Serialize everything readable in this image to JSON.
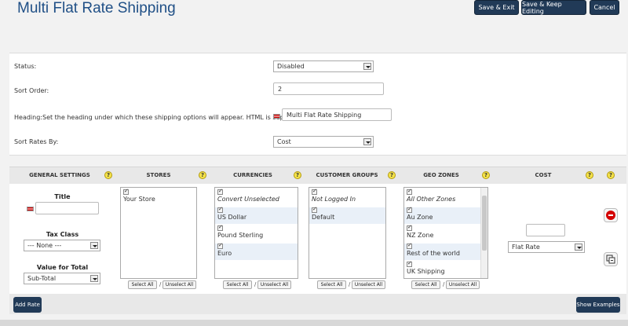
{
  "page": {
    "title": "Multi Flat Rate Shipping"
  },
  "header": {
    "save_exit": "Save & Exit",
    "save_keep": "Save & Keep Editing",
    "cancel": "Cancel"
  },
  "form": {
    "status_label": "Status:",
    "status_value": "Disabled",
    "sort_order_label": "Sort Order:",
    "sort_order_value": "2",
    "heading_label": "Heading:Set the heading under which these shipping options will appear. HTML is supported.",
    "heading_value": "Multi Flat Rate Shipping",
    "sort_rates_label": "Sort Rates By:",
    "sort_rates_value": "Cost"
  },
  "columns": {
    "general": "GENERAL SETTINGS",
    "stores": "STORES",
    "currencies": "CURRENCIES",
    "customer_groups": "CUSTOMER GROUPS",
    "geo_zones": "GEO ZONES",
    "cost": "COST",
    "help": "?"
  },
  "general": {
    "title_label": "Title",
    "title_value": "",
    "tax_class_label": "Tax Class",
    "tax_class_value": "--- None ---",
    "value_total_label": "Value for Total",
    "value_total_value": "Sub-Total"
  },
  "stores": [
    {
      "label": "Your Store",
      "italic": false
    }
  ],
  "currencies": [
    {
      "label": "Convert Unselected",
      "italic": true
    },
    {
      "label": "US Dollar",
      "italic": false
    },
    {
      "label": "Pound Sterling",
      "italic": false
    },
    {
      "label": "Euro",
      "italic": false
    }
  ],
  "customer_groups": [
    {
      "label": "Not Logged In",
      "italic": true
    },
    {
      "label": "Default",
      "italic": false
    }
  ],
  "geo_zones": [
    {
      "label": "All Other Zones",
      "italic": true
    },
    {
      "label": "Au Zone",
      "italic": false
    },
    {
      "label": "NZ Zone",
      "italic": false
    },
    {
      "label": "Rest of the world",
      "italic": false
    },
    {
      "label": "UK Shipping",
      "italic": false
    },
    {
      "label": "",
      "italic": false
    }
  ],
  "list_actions": {
    "select_all": "Select All",
    "unselect_all": "Unselect All",
    "sep": "/"
  },
  "cost": {
    "value": "",
    "type": "Flat Rate"
  },
  "footer": {
    "add_rate": "Add Rate",
    "show_examples": "Show Examples"
  }
}
